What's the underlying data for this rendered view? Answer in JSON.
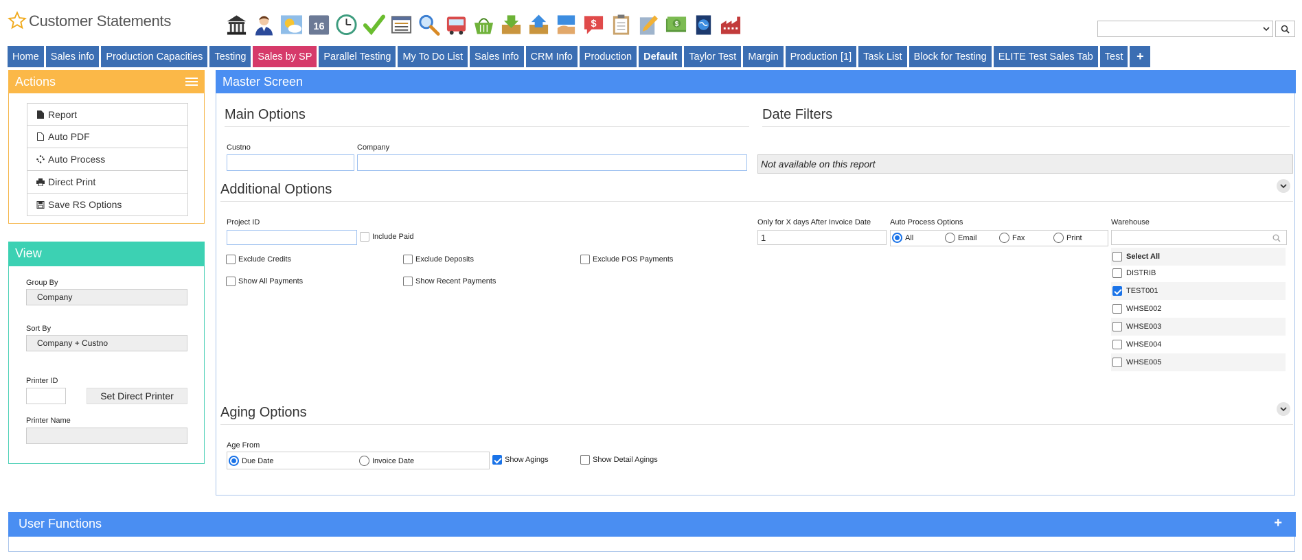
{
  "header": {
    "title": "Customer Statements"
  },
  "toolbar": {
    "icons": [
      "bank-icon",
      "user-icon",
      "weather-icon",
      "calendar-icon",
      "clock-icon",
      "checkmark-icon",
      "list-window-icon",
      "magnifier-icon",
      "bus-icon",
      "basket-icon",
      "download-box-icon",
      "upload-box-icon",
      "hand-card-icon",
      "dollar-speech-icon",
      "clipboard-icon",
      "pencil-icon",
      "money-icon",
      "globe-book-icon",
      "factory-icon"
    ],
    "calendar_day": "16"
  },
  "search": {
    "value": ""
  },
  "tabs": [
    {
      "label": "Home"
    },
    {
      "label": "Sales info"
    },
    {
      "label": "Production Capacities"
    },
    {
      "label": "Testing"
    },
    {
      "label": "Sales by SP"
    },
    {
      "label": "Parallel Testing"
    },
    {
      "label": "My To Do List"
    },
    {
      "label": "Sales Info"
    },
    {
      "label": "CRM Info"
    },
    {
      "label": "Production"
    },
    {
      "label": "Default"
    },
    {
      "label": "Taylor Test"
    },
    {
      "label": "Margin"
    },
    {
      "label": "Production [1]"
    },
    {
      "label": "Task List"
    },
    {
      "label": "Block for Testing"
    },
    {
      "label": "ELITE Test Sales Tab"
    },
    {
      "label": "Test"
    },
    {
      "label": "+"
    }
  ],
  "actions": {
    "title": "Actions",
    "items": [
      {
        "label": "Report",
        "icon": "file-icon"
      },
      {
        "label": "Auto PDF",
        "icon": "file-outline-icon"
      },
      {
        "label": "Auto Process",
        "icon": "spinner-icon"
      },
      {
        "label": "Direct Print",
        "icon": "printer-icon"
      },
      {
        "label": "Save RS Options",
        "icon": "floppy-icon"
      }
    ]
  },
  "view": {
    "title": "View",
    "group_by_label": "Group By",
    "group_by_value": "Company",
    "sort_by_label": "Sort By",
    "sort_by_value": "Company + Custno",
    "printer_id_label": "Printer ID",
    "printer_id_value": "",
    "set_printer_label": "Set Direct Printer",
    "printer_name_label": "Printer Name",
    "printer_name_value": ""
  },
  "master": {
    "title": "Master Screen",
    "main_options": {
      "title": "Main Options",
      "custno_label": "Custno",
      "custno_value": "",
      "company_label": "Company",
      "company_value": ""
    },
    "date_filters": {
      "title": "Date Filters",
      "note": "Not available on this report"
    },
    "additional": {
      "title": "Additional Options",
      "project_id_label": "Project ID",
      "project_id_value": "",
      "include_paid": "Include Paid",
      "exclude_credits": "Exclude Credits",
      "exclude_deposits": "Exclude Deposits",
      "exclude_pos": "Exclude POS Payments",
      "show_all_payments": "Show All Payments",
      "show_recent_payments": "Show Recent Payments",
      "days_label": "Only for X days After Invoice Date",
      "days_value": "1",
      "auto_process_label": "Auto Process Options",
      "auto_process_options": [
        "All",
        "Email",
        "Fax",
        "Print"
      ],
      "auto_process_selected": "All",
      "warehouse_label": "Warehouse",
      "warehouse_search": "",
      "warehouses": [
        {
          "label": "Select All",
          "checked": false
        },
        {
          "label": "DISTRIB",
          "checked": false
        },
        {
          "label": "TEST001",
          "checked": true
        },
        {
          "label": "WHSE002",
          "checked": false
        },
        {
          "label": "WHSE003",
          "checked": false
        },
        {
          "label": "WHSE004",
          "checked": false
        },
        {
          "label": "WHSE005",
          "checked": false
        }
      ]
    },
    "aging": {
      "title": "Aging Options",
      "age_from_label": "Age From",
      "due_date": "Due Date",
      "invoice_date": "Invoice Date",
      "age_from_selected": "Due Date",
      "show_agings": "Show Agings",
      "show_agings_checked": true,
      "show_detail_agings": "Show Detail Agings",
      "show_detail_agings_checked": false
    }
  },
  "user_functions": {
    "title": "User Functions"
  }
}
